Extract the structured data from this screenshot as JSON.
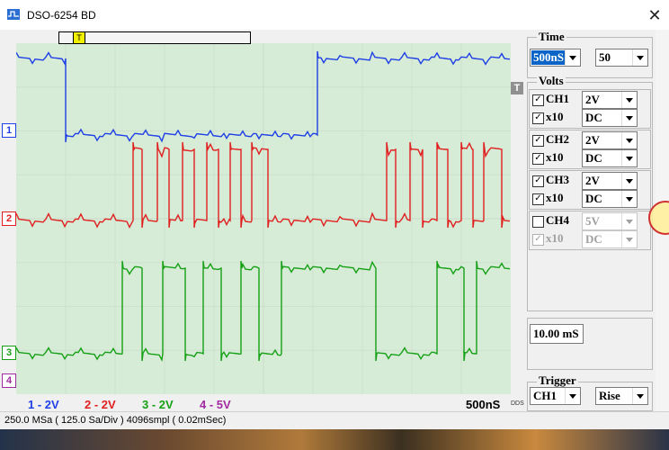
{
  "window": {
    "title": "DSO-6254 BD",
    "close_glyph": "✕"
  },
  "scope": {
    "trigger_marker": "T",
    "right_trigger_marker": "T",
    "channel_markers": [
      "1",
      "2",
      "3",
      "4"
    ],
    "legend": [
      {
        "label": "1 - 2V",
        "color": "#1f3fe6"
      },
      {
        "label": "2 - 2V",
        "color": "#e02020"
      },
      {
        "label": "3 - 2V",
        "color": "#16a016"
      },
      {
        "label": "4 - 5V",
        "color": "#a02aa0"
      }
    ],
    "timebase": "500nS",
    "dds": "DDS",
    "grid_color": "#cde0cd",
    "plot_bg": "#d6ecd6"
  },
  "status": {
    "text": "250.0 MSa ( 125.0 Sa/Div ) 4096smpl ( 0.02mSec)"
  },
  "panel": {
    "time": {
      "label": "Time",
      "timebase": "500nS",
      "position": "50"
    },
    "volts": {
      "label": "Volts",
      "channels": [
        {
          "name": "CH1",
          "enabled": true,
          "volts": "2V",
          "probe": "x10",
          "probe_on": true,
          "coupling": "DC"
        },
        {
          "name": "CH2",
          "enabled": true,
          "volts": "2V",
          "probe": "x10",
          "probe_on": true,
          "coupling": "DC"
        },
        {
          "name": "CH3",
          "enabled": true,
          "volts": "2V",
          "probe": "x10",
          "probe_on": true,
          "coupling": "DC"
        },
        {
          "name": "CH4",
          "enabled": false,
          "volts": "5V",
          "probe": "x10",
          "probe_on": true,
          "coupling": "DC"
        }
      ]
    },
    "record_length": "10.00 mS",
    "trigger": {
      "label": "Trigger",
      "source": "CH1",
      "edge": "Rise"
    }
  }
}
